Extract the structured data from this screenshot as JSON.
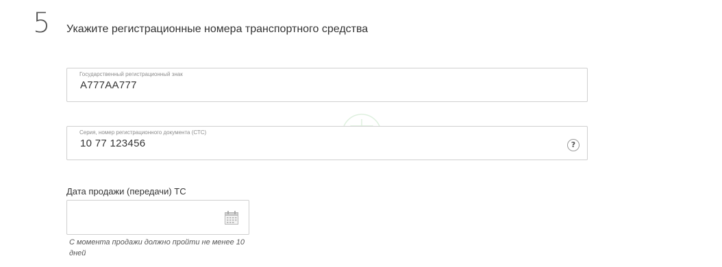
{
  "step": {
    "number": "5",
    "title": "Укажите регистрационные номера транспортного средства"
  },
  "plate_field": {
    "label": "Государственный регистрационный знак",
    "value": "А777АА777"
  },
  "sts_field": {
    "label": "Серия, номер регистрационного документа (СТС)",
    "value": "10 77 123456",
    "help_icon": "question-circle-icon"
  },
  "sale_date": {
    "label": "Дата продажи (передачи) ТС",
    "value": "",
    "calendar_icon": "calendar-icon",
    "hint": "С момента продажи должно пройти не менее 10 дней"
  },
  "colors": {
    "border": "#cfcfcf",
    "text": "#333333",
    "label": "#8c8c8c",
    "watermark": "#4caf50"
  }
}
